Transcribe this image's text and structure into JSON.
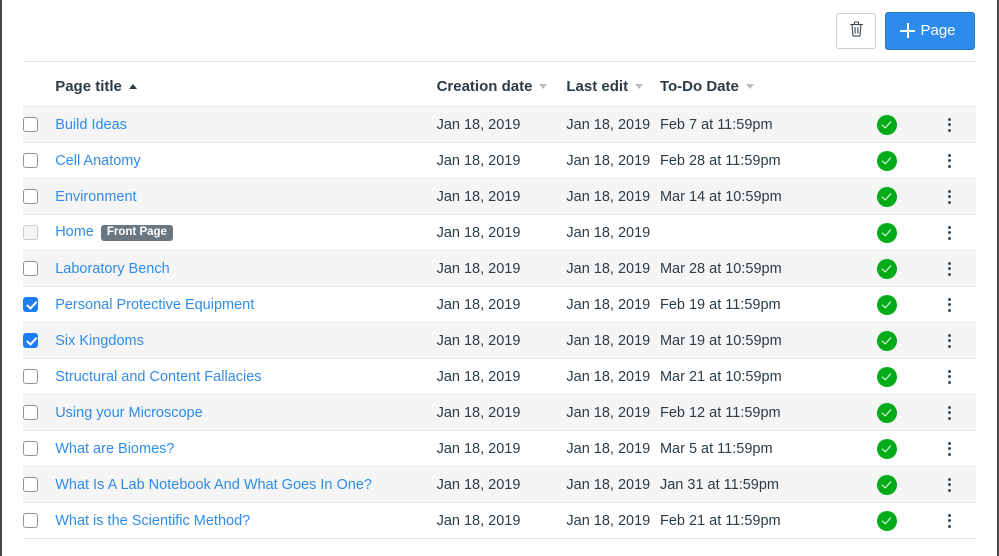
{
  "toolbar": {
    "delete_label": "Delete",
    "delete_icon": "trash-icon",
    "add_page_label": "Page",
    "add_page_icon": "plus-icon",
    "accent_color": "#2d8ceb"
  },
  "table": {
    "columns": [
      {
        "key": "title",
        "label": "Page title",
        "sort": "asc"
      },
      {
        "key": "creation",
        "label": "Creation date",
        "sort": "none"
      },
      {
        "key": "lastedit",
        "label": "Last edit",
        "sort": "none"
      },
      {
        "key": "todo",
        "label": "To-Do Date",
        "sort": "none"
      }
    ],
    "status": {
      "published_icon": "published-check-icon",
      "published_color": "#00ac18",
      "menu_icon": "kebab-menu-icon"
    },
    "front_page_badge": "Front Page",
    "rows": [
      {
        "title": "Build Ideas",
        "creation": "Jan 18, 2019",
        "lastedit": "Jan 18, 2019",
        "todo": "Feb 7 at 11:59pm",
        "checked": false,
        "disabled": false,
        "front_page": false,
        "published": true
      },
      {
        "title": "Cell Anatomy",
        "creation": "Jan 18, 2019",
        "lastedit": "Jan 18, 2019",
        "todo": "Feb 28 at 11:59pm",
        "checked": false,
        "disabled": false,
        "front_page": false,
        "published": true
      },
      {
        "title": "Environment",
        "creation": "Jan 18, 2019",
        "lastedit": "Jan 18, 2019",
        "todo": "Mar 14 at 10:59pm",
        "checked": false,
        "disabled": false,
        "front_page": false,
        "published": true
      },
      {
        "title": "Home",
        "creation": "Jan 18, 2019",
        "lastedit": "Jan 18, 2019",
        "todo": "",
        "checked": false,
        "disabled": true,
        "front_page": true,
        "published": true
      },
      {
        "title": "Laboratory Bench",
        "creation": "Jan 18, 2019",
        "lastedit": "Jan 18, 2019",
        "todo": "Mar 28 at 10:59pm",
        "checked": false,
        "disabled": false,
        "front_page": false,
        "published": true
      },
      {
        "title": "Personal Protective Equipment",
        "creation": "Jan 18, 2019",
        "lastedit": "Jan 18, 2019",
        "todo": "Feb 19 at 11:59pm",
        "checked": true,
        "disabled": false,
        "front_page": false,
        "published": true
      },
      {
        "title": "Six Kingdoms",
        "creation": "Jan 18, 2019",
        "lastedit": "Jan 18, 2019",
        "todo": "Mar 19 at 10:59pm",
        "checked": true,
        "disabled": false,
        "front_page": false,
        "published": true
      },
      {
        "title": "Structural and Content Fallacies",
        "creation": "Jan 18, 2019",
        "lastedit": "Jan 18, 2019",
        "todo": "Mar 21 at 10:59pm",
        "checked": false,
        "disabled": false,
        "front_page": false,
        "published": true
      },
      {
        "title": "Using your Microscope",
        "creation": "Jan 18, 2019",
        "lastedit": "Jan 18, 2019",
        "todo": "Feb 12 at 11:59pm",
        "checked": false,
        "disabled": false,
        "front_page": false,
        "published": true
      },
      {
        "title": "What are Biomes?",
        "creation": "Jan 18, 2019",
        "lastedit": "Jan 18, 2019",
        "todo": "Mar 5 at 11:59pm",
        "checked": false,
        "disabled": false,
        "front_page": false,
        "published": true
      },
      {
        "title": "What Is A Lab Notebook And What Goes In One?",
        "creation": "Jan 18, 2019",
        "lastedit": "Jan 18, 2019",
        "todo": "Jan 31 at 11:59pm",
        "checked": false,
        "disabled": false,
        "front_page": false,
        "published": true
      },
      {
        "title": "What is the Scientific Method?",
        "creation": "Jan 18, 2019",
        "lastedit": "Jan 18, 2019",
        "todo": "Feb 21 at 11:59pm",
        "checked": false,
        "disabled": false,
        "front_page": false,
        "published": true
      }
    ]
  }
}
